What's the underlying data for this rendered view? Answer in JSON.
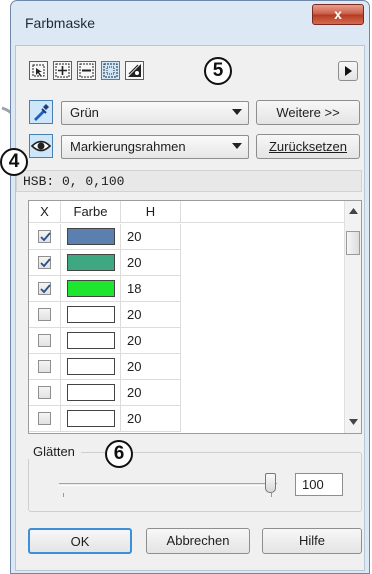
{
  "window": {
    "title": "Farbmaske",
    "close_label": "x"
  },
  "toolbar": {
    "tools": [
      "rect-select-icon",
      "add-select-icon",
      "subtract-select-icon",
      "intersect-select-icon",
      "invert-mask-icon"
    ],
    "callout_5": "5",
    "overflow_icon": "play-right-icon"
  },
  "row1": {
    "picker_icon": "eyedropper-icon",
    "color_value": "Grün",
    "more_label": "Weitere >>"
  },
  "row2": {
    "view_icon": "eye-icon",
    "mode_value": "Markierungsrahmen",
    "reset_label": "Zurücksetzen",
    "callout_4": "4"
  },
  "hsb": {
    "text": "HSB:  0, 0,100"
  },
  "grid": {
    "columns": [
      "X",
      "Farbe",
      "H"
    ],
    "rows": [
      {
        "checked": true,
        "color": "#5b7fae",
        "h": "20"
      },
      {
        "checked": true,
        "color": "#3ea882",
        "h": "20"
      },
      {
        "checked": true,
        "color": "#1ee62f",
        "h": "18"
      },
      {
        "checked": false,
        "color": "#ffffff",
        "h": "20"
      },
      {
        "checked": false,
        "color": "#ffffff",
        "h": "20"
      },
      {
        "checked": false,
        "color": "#ffffff",
        "h": "20"
      },
      {
        "checked": false,
        "color": "#ffffff",
        "h": "20"
      },
      {
        "checked": false,
        "color": "#ffffff",
        "h": "20"
      }
    ]
  },
  "smooth": {
    "label": "Glätten",
    "callout_6": "6",
    "value": "100"
  },
  "buttons": {
    "ok": "OK",
    "cancel": "Abbrechen",
    "help": "Hilfe"
  }
}
